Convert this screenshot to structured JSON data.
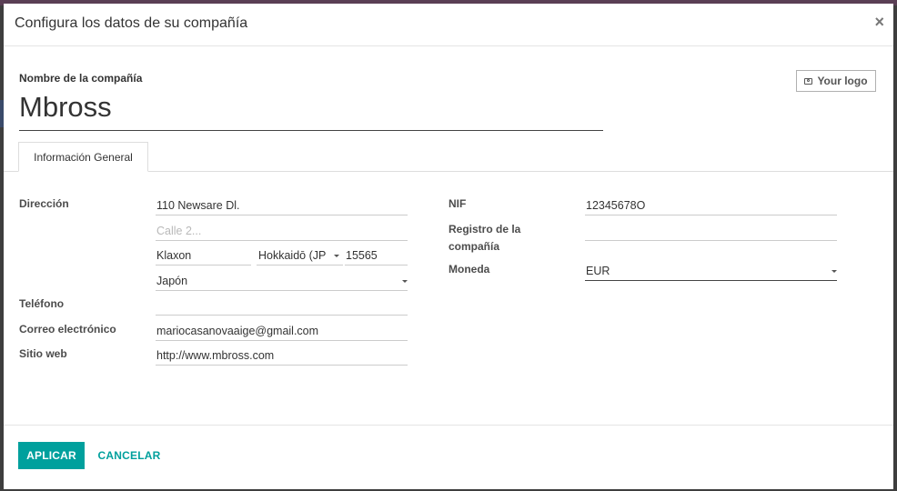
{
  "dialog": {
    "title": "Configura los datos de su compañía",
    "close_label": "×"
  },
  "company": {
    "name_label": "Nombre de la compañía",
    "name_value": "Mbross",
    "logo_button": "Your logo"
  },
  "tabs": [
    {
      "label": "Información General",
      "active": true
    }
  ],
  "form": {
    "address_label": "Dirección",
    "street": "110 Newsare Dl.",
    "street2_placeholder": "Calle 2...",
    "city": "Klaxon",
    "state": "Hokkaidō (JP",
    "zip": "15565",
    "country": "Japón",
    "phone_label": "Teléfono",
    "phone": "",
    "email_label": "Correo electrónico",
    "email": "mariocasanovaaige@gmail.com",
    "website_label": "Sitio web",
    "website": "http://www.mbross.com",
    "vat_label": "NIF",
    "vat": "12345678O",
    "registry_label_line1": "Registro de la",
    "registry_label_line2": "compañía",
    "registry": "",
    "currency_label": "Moneda",
    "currency": "EUR"
  },
  "footer": {
    "apply_label": "APLICAR",
    "cancel_label": "CANCELAR"
  },
  "colors": {
    "accent": "#00a09d",
    "backdrop": "#3e3e3e"
  }
}
